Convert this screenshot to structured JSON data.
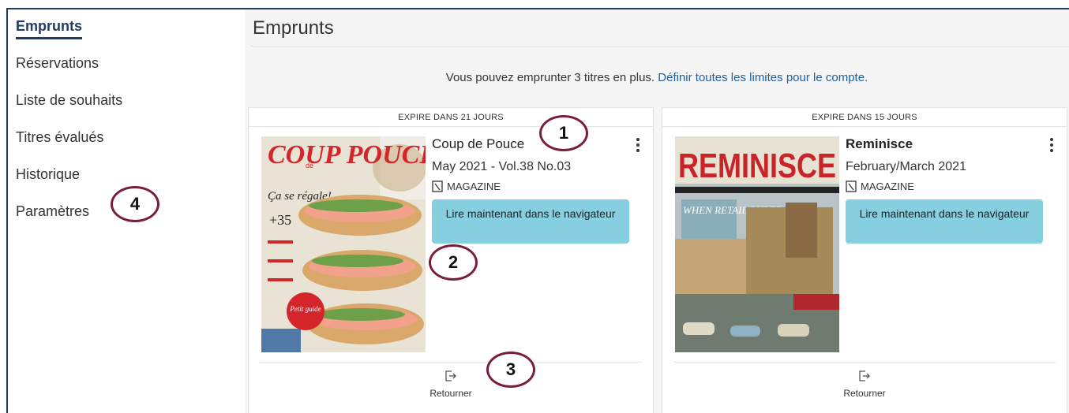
{
  "sidebar": {
    "items": [
      {
        "label": "Emprunts",
        "active": true
      },
      {
        "label": "Réservations"
      },
      {
        "label": "Liste de souhaits"
      },
      {
        "label": "Titres évalués"
      },
      {
        "label": "Historique"
      },
      {
        "label": "Paramètres"
      }
    ]
  },
  "main": {
    "title": "Emprunts",
    "limit_text": "Vous pouvez emprunter 3 titres en plus.",
    "limit_link": "Définir toutes les limites pour le compte."
  },
  "cards": [
    {
      "expires": "EXPIRE DANS 21 JOURS",
      "title": "Coup de Pouce",
      "issue": "May 2021 - Vol.38 No.03",
      "format": "MAGAZINE",
      "read_label": "Lire maintenant dans le navigateur",
      "return_label": "Retourner",
      "cover": {
        "masthead": "COUP POUCE",
        "tag": "de",
        "tagline": "Ça se régale!",
        "count": "+35",
        "badge": "Petit guide"
      }
    },
    {
      "expires": "EXPIRE DANS 15 JOURS",
      "title": "Reminisce",
      "issue": "February/March 2021",
      "format": "MAGAZINE",
      "read_label": "Lire maintenant dans le navigateur",
      "return_label": "Retourner",
      "cover": {
        "masthead": "REMINISCE",
        "headline": "WHEN RETAIL RULED"
      }
    }
  ],
  "callouts": [
    "1",
    "2",
    "3",
    "4"
  ],
  "colors": {
    "accent": "#1f3c64",
    "button": "#86cfe0",
    "link": "#1f5fa0",
    "callout": "#7a1c3c"
  }
}
